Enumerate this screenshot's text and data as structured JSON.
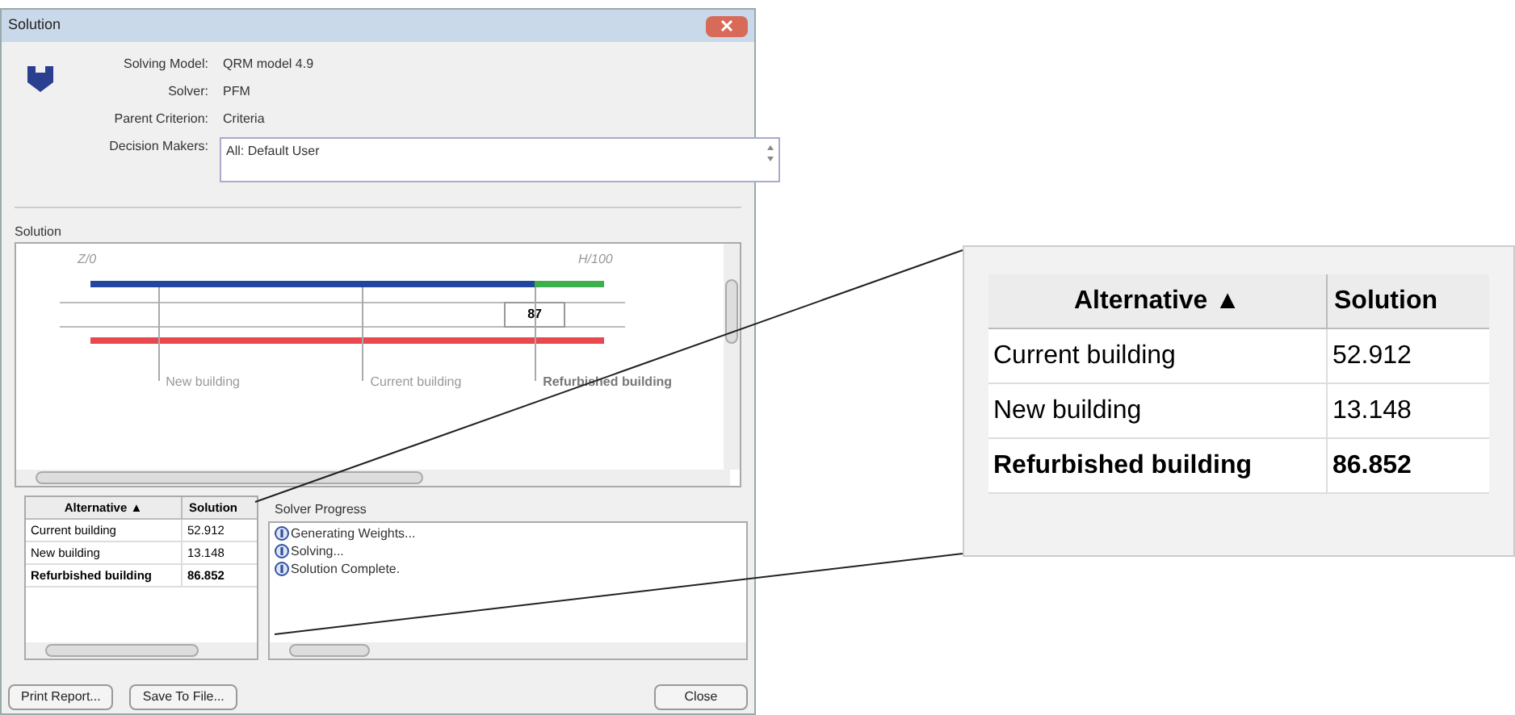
{
  "window": {
    "title": "Solution"
  },
  "details": [
    {
      "label": "Solving Model:",
      "value": "QRM model 4.9"
    },
    {
      "label": "Solver:",
      "value": "PFM"
    },
    {
      "label": "Parent Criterion:",
      "value": "Criteria"
    }
  ],
  "decision_makers": {
    "label": "Decision Makers:",
    "value": "All: Default User"
  },
  "solution": {
    "title": "Solution",
    "axis_min": "Z/0",
    "axis_max": "H/100",
    "value": "87",
    "level": 0.865,
    "markers": [
      {
        "label": "New building",
        "level": 0.131,
        "selected": false
      },
      {
        "label": "Current building",
        "level": 0.529,
        "selected": false
      },
      {
        "label": "Refurbished building",
        "level": 0.865,
        "selected": true
      }
    ]
  },
  "table": {
    "columns": [
      "Alternative ▲",
      "Solution"
    ],
    "rows": [
      {
        "cells": [
          "Current building",
          "52.912"
        ],
        "selected": false
      },
      {
        "cells": [
          "New building",
          "13.148"
        ],
        "selected": false
      },
      {
        "cells": [
          "Refurbished building",
          "86.852"
        ],
        "selected": true
      }
    ]
  },
  "progress": {
    "title": "Solver Progress",
    "items": [
      "Generating Weights...",
      "Solving...",
      "Solution Complete."
    ]
  },
  "buttons": [
    "Print Report...",
    "Save To File...",
    "Close"
  ],
  "zoom_table": {
    "columns": [
      "Alternative ▲",
      "Solution"
    ],
    "rows": [
      {
        "cells": [
          "Current building",
          "52.912"
        ],
        "selected": false
      },
      {
        "cells": [
          "New building",
          "13.148"
        ],
        "selected": false
      },
      {
        "cells": [
          "Refurbished building",
          "86.852"
        ],
        "selected": true
      }
    ]
  }
}
